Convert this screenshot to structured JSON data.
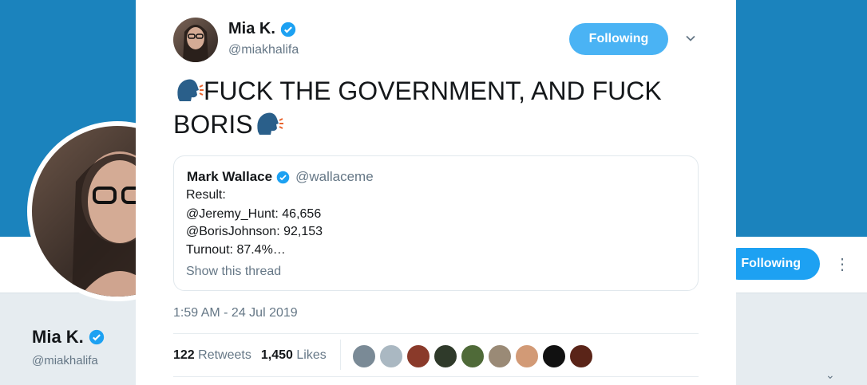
{
  "background": {
    "profile_name": "Mia K.",
    "profile_handle": "@miakhalifa",
    "following_label": "Following",
    "more_glyph": "⋮",
    "chevron_glyph": "⌄"
  },
  "tweet": {
    "author_name": "Mia K.",
    "author_handle": "@miakhalifa",
    "follow_label": "Following",
    "text_part1": "FUCK THE GOVERNMENT, AND FUCK",
    "text_part2": "BORIS",
    "timestamp": "1:59 AM - 24 Jul 2019",
    "retweets_count": "122",
    "retweets_label": "Retweets",
    "likes_count": "1,450",
    "likes_label": "Likes"
  },
  "quoted": {
    "name": "Mark Wallace",
    "handle": "@wallaceme",
    "lines": [
      "Result:",
      "@Jeremy_Hunt: 46,656",
      "@BorisJohnson: 92,153",
      "Turnout: 87.4%…"
    ],
    "show_thread": "Show this thread"
  },
  "colors": {
    "banner": "#1b83bd",
    "accent": "#1da1f2",
    "follow_button": "#4ab3f4",
    "verified": "#1da1f2"
  },
  "liker_colors": [
    "#7a8a96",
    "#aab8c2",
    "#8a3a2a",
    "#2f3a2a",
    "#4f6a38",
    "#9a8a76",
    "#d29a76",
    "#111111",
    "#5a2418"
  ]
}
